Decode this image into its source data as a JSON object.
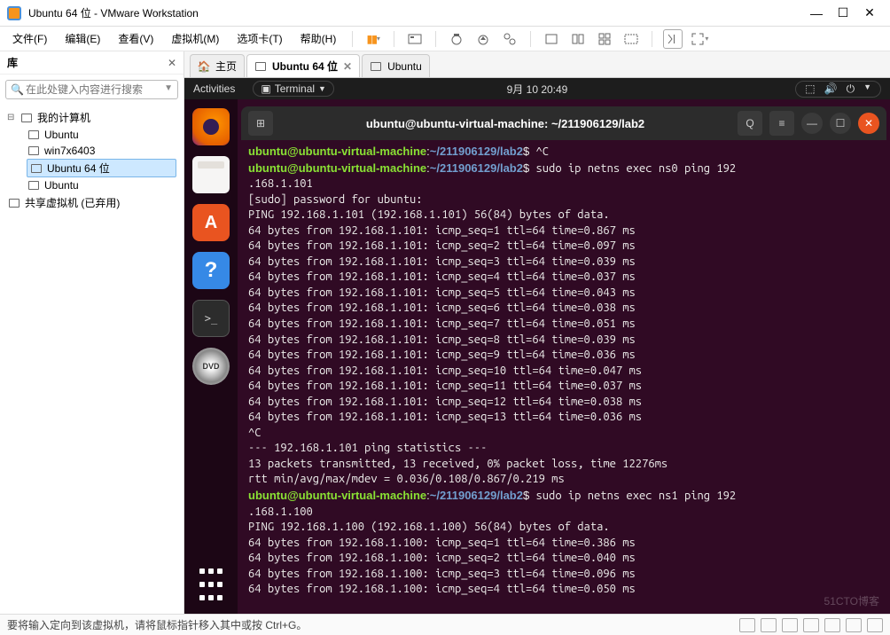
{
  "window": {
    "title": "Ubuntu 64 位 - VMware Workstation"
  },
  "menubar": {
    "items": [
      "文件(F)",
      "编辑(E)",
      "查看(V)",
      "虚拟机(M)",
      "选项卡(T)",
      "帮助(H)"
    ]
  },
  "library": {
    "title": "库",
    "search_placeholder": "在此处键入内容进行搜索",
    "root": "我的计算机",
    "vms": [
      "Ubuntu",
      "win7x6403",
      "Ubuntu 64 位",
      "Ubuntu"
    ],
    "shared": "共享虚拟机 (已弃用)"
  },
  "tabs": {
    "home": "主页",
    "items": [
      "Ubuntu 64 位",
      "Ubuntu"
    ],
    "active_index": 0
  },
  "gnome": {
    "activities": "Activities",
    "app_menu": "Terminal",
    "clock": "9月 10  20:49"
  },
  "terminal": {
    "title": "ubuntu@ubuntu-virtual-machine: ~/211906129/lab2",
    "prompt_user": "ubuntu@ubuntu-virtual-machine",
    "prompt_path": "~/211906129/lab2",
    "lines": [
      {
        "t": "prompt",
        "cmd": "^C"
      },
      {
        "t": "prompt",
        "cmd": "sudo ip netns exec ns0 ping 192"
      },
      {
        "t": "plain",
        "text": ".168.1.101"
      },
      {
        "t": "plain",
        "text": "[sudo] password for ubuntu:"
      },
      {
        "t": "plain",
        "text": "PING 192.168.1.101 (192.168.1.101) 56(84) bytes of data."
      },
      {
        "t": "plain",
        "text": "64 bytes from 192.168.1.101: icmp_seq=1 ttl=64 time=0.867 ms"
      },
      {
        "t": "plain",
        "text": "64 bytes from 192.168.1.101: icmp_seq=2 ttl=64 time=0.097 ms"
      },
      {
        "t": "plain",
        "text": "64 bytes from 192.168.1.101: icmp_seq=3 ttl=64 time=0.039 ms"
      },
      {
        "t": "plain",
        "text": "64 bytes from 192.168.1.101: icmp_seq=4 ttl=64 time=0.037 ms"
      },
      {
        "t": "plain",
        "text": "64 bytes from 192.168.1.101: icmp_seq=5 ttl=64 time=0.043 ms"
      },
      {
        "t": "plain",
        "text": "64 bytes from 192.168.1.101: icmp_seq=6 ttl=64 time=0.038 ms"
      },
      {
        "t": "plain",
        "text": "64 bytes from 192.168.1.101: icmp_seq=7 ttl=64 time=0.051 ms"
      },
      {
        "t": "plain",
        "text": "64 bytes from 192.168.1.101: icmp_seq=8 ttl=64 time=0.039 ms"
      },
      {
        "t": "plain",
        "text": "64 bytes from 192.168.1.101: icmp_seq=9 ttl=64 time=0.036 ms"
      },
      {
        "t": "plain",
        "text": "64 bytes from 192.168.1.101: icmp_seq=10 ttl=64 time=0.047 ms"
      },
      {
        "t": "plain",
        "text": "64 bytes from 192.168.1.101: icmp_seq=11 ttl=64 time=0.037 ms"
      },
      {
        "t": "plain",
        "text": "64 bytes from 192.168.1.101: icmp_seq=12 ttl=64 time=0.038 ms"
      },
      {
        "t": "plain",
        "text": "64 bytes from 192.168.1.101: icmp_seq=13 ttl=64 time=0.036 ms"
      },
      {
        "t": "plain",
        "text": "^C"
      },
      {
        "t": "plain",
        "text": "--- 192.168.1.101 ping statistics ---"
      },
      {
        "t": "plain",
        "text": "13 packets transmitted, 13 received, 0% packet loss, time 12276ms"
      },
      {
        "t": "plain",
        "text": "rtt min/avg/max/mdev = 0.036/0.108/0.867/0.219 ms"
      },
      {
        "t": "prompt",
        "cmd": "sudo ip netns exec ns1 ping 192"
      },
      {
        "t": "plain",
        "text": ".168.1.100"
      },
      {
        "t": "plain",
        "text": "PING 192.168.1.100 (192.168.1.100) 56(84) bytes of data."
      },
      {
        "t": "plain",
        "text": "64 bytes from 192.168.1.100: icmp_seq=1 ttl=64 time=0.386 ms"
      },
      {
        "t": "plain",
        "text": "64 bytes from 192.168.1.100: icmp_seq=2 ttl=64 time=0.040 ms"
      },
      {
        "t": "plain",
        "text": "64 bytes from 192.168.1.100: icmp_seq=3 ttl=64 time=0.096 ms"
      },
      {
        "t": "plain",
        "text": "64 bytes from 192.168.1.100: icmp_seq=4 ttl=64 time=0.050 ms"
      }
    ]
  },
  "statusbar": {
    "text": "要将输入定向到该虚拟机，请将鼠标指针移入其中或按 Ctrl+G。"
  },
  "watermark": "51CTO博客"
}
